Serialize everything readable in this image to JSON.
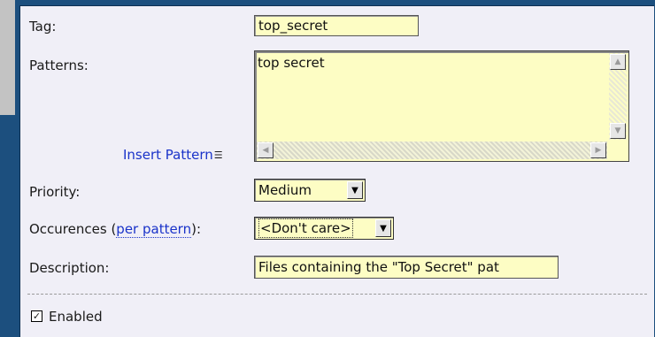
{
  "form": {
    "tag": {
      "label": "Tag:",
      "value": "top_secret"
    },
    "patterns": {
      "label": "Patterns:",
      "value": "top secret",
      "insert_link": "Insert Pattern",
      "insert_icon": "menu-lines-icon"
    },
    "priority": {
      "label": "Priority:",
      "value": "Medium"
    },
    "occurences": {
      "label_prefix": "Occurences (",
      "label_link": "per pattern",
      "label_suffix": "):",
      "value": "<Don't care>"
    },
    "description": {
      "label": "Description:",
      "value": "Files containing the \"Top Secret\" pat"
    },
    "enabled": {
      "label": "Enabled",
      "checked": true,
      "check_glyph": "✓"
    }
  },
  "scrollbar": {
    "up": "▲",
    "down": "▼",
    "left": "◀",
    "right": "▶"
  },
  "select_arrow": "▼",
  "colors": {
    "panel": "#f0eff7",
    "field": "#fdfdc4",
    "frame": "#1c4f7e",
    "link": "#1a33c9"
  }
}
